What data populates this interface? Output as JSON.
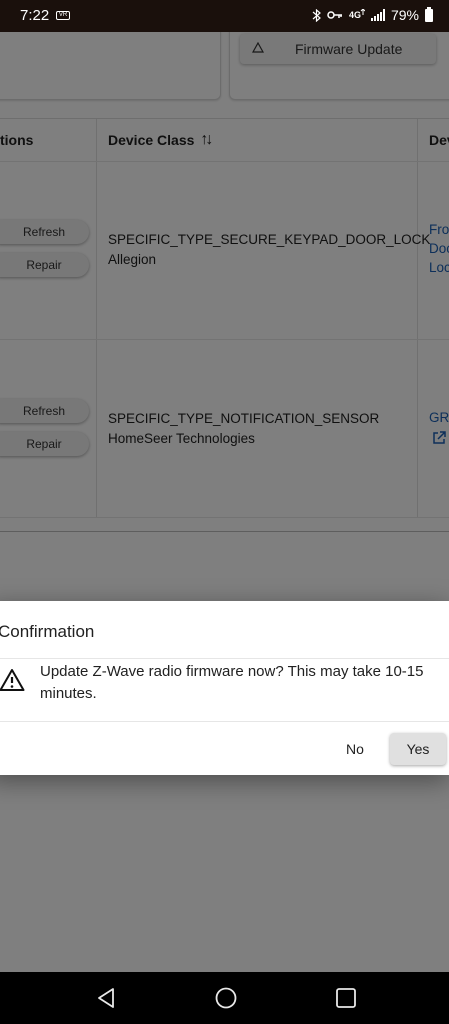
{
  "status_bar": {
    "time": "7:22",
    "vr_badge": "VR",
    "battery": "79%"
  },
  "toolbar": {
    "firmware_update_label": "Firmware Update"
  },
  "table": {
    "headers": {
      "actions": "tions",
      "device_class": "Device Class",
      "device": "Dev"
    },
    "rows": [
      {
        "refresh_label": "Refresh",
        "repair_label": "Repair",
        "device_class_line1": "SPECIFIC_TYPE_SECURE_KEYPAD_DOOR_LOCK",
        "device_class_line2": "Allegion",
        "device_link_lines": [
          "Fro",
          "Doo",
          "Loc"
        ]
      },
      {
        "refresh_label": "Refresh",
        "repair_label": "Repair",
        "device_class_line1": "SPECIFIC_TYPE_NOTIFICATION_SENSOR",
        "device_class_line2": "HomeSeer Technologies",
        "device_link_lines": [
          "GR"
        ]
      }
    ]
  },
  "dialog": {
    "title": "Confirmation",
    "message": "Update Z-Wave radio firmware now? This may take 10-15 minutes.",
    "no_label": "No",
    "yes_label": "Yes"
  },
  "icons": {
    "warning": "warning-triangle-icon",
    "sort": "sort-arrows-icon",
    "firmware": "triangle-up-icon",
    "external_link": "external-link-icon"
  },
  "colors": {
    "link": "#1a5fb4",
    "overlay": "rgba(0,0,0,0.5)",
    "status_bar": "#1a100c"
  }
}
